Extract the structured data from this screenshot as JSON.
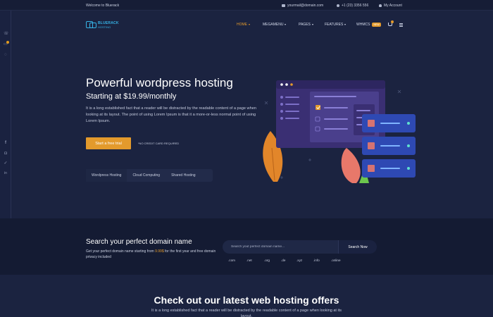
{
  "topbar": {
    "welcome": "Welcome to Bluerack",
    "email": "yourmail@domain.com",
    "phone": "+1 (23) 3356 556",
    "account": "My Account"
  },
  "logo": {
    "brand": "BLUERACK",
    "sub": "HOSTING"
  },
  "nav": {
    "items": [
      {
        "label": "HOME"
      },
      {
        "label": "MEGAMENU"
      },
      {
        "label": "PAGES"
      },
      {
        "label": "FEATURES"
      },
      {
        "label": "WHMCS",
        "badge": "NEW"
      }
    ],
    "cart_count": "0"
  },
  "hero": {
    "title": "Powerful wordpress hosting",
    "subtitle": "Starting at $19.99/monthly",
    "description": "It is a long established fact that a reader will be distracted by the readable content of a page when looking at its layout. The point of using Lorem Ipsum is that it a more-or-less normal point of using Lorem Ipsum.",
    "cta_label": "Start a free trial",
    "no_card": "*NO CREDIT CARD REQUIRED",
    "tabs": [
      "Wordpress Hosting",
      "Cloud Computing",
      "Shared Hosting"
    ]
  },
  "domain_search": {
    "title": "Search your perfect domain name",
    "desc_before": "Get your perfect domain name starting from ",
    "price": "9.99$",
    "desc_after": " for the first year and free domain privacy included",
    "placeholder": "Search yout perfect domain name...",
    "button_label": "Search Now",
    "tlds": [
      ".com",
      ".net",
      ".org",
      ".de",
      ".xyz",
      ".info",
      ".online"
    ]
  },
  "offers": {
    "title": "Check out our latest web hosting offers",
    "description": "It is a long established fact that a reader will be distracted by the readable content of a page when looking at its layout."
  },
  "colors": {
    "background": "#1b2340",
    "accent": "#e39a2c",
    "brand": "#36b3e6",
    "band": "#141b33"
  }
}
